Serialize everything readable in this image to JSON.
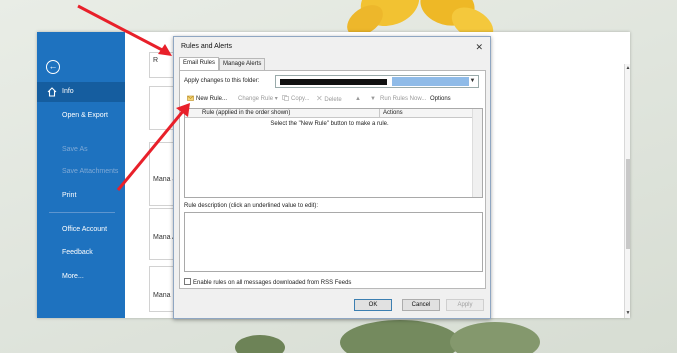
{
  "backstage": {
    "items": [
      {
        "label": "Info"
      },
      {
        "label": "Open & Export"
      },
      {
        "label": "Save As"
      },
      {
        "label": "Save Attachments"
      },
      {
        "label": "Print"
      },
      {
        "label": "Office Account"
      },
      {
        "label": "Feedback"
      },
      {
        "label": "More..."
      }
    ]
  },
  "content": {
    "tiles": [
      {
        "label": "R"
      },
      {
        "label": ""
      },
      {
        "label": "Mana &"
      },
      {
        "label": "Mana Ar"
      },
      {
        "label": "Mana"
      }
    ]
  },
  "dialog": {
    "title": "Rules and Alerts",
    "tabs": [
      {
        "label": "Email Rules"
      },
      {
        "label": "Manage Alerts"
      }
    ],
    "folder_label": "Apply changes to this folder:",
    "toolbar": {
      "new_rule": "New Rule...",
      "change_rule": "Change Rule",
      "copy": "Copy...",
      "delete": "Delete",
      "run_rules_now": "Run Rules Now...",
      "options": "Options"
    },
    "table": {
      "col_rule": "Rule (applied in the order shown)",
      "col_actions": "Actions",
      "empty_message": "Select the \"New Rule\" button to make a rule."
    },
    "description_label": "Rule description (click an underlined value to edit):",
    "rss_checkbox_label": "Enable rules on all messages downloaded from RSS Feeds",
    "buttons": {
      "ok": "OK",
      "cancel": "Cancel",
      "apply": "Apply"
    }
  },
  "colors": {
    "backstage_blue": "#1e72bf",
    "annotation_red": "#e8202a"
  }
}
